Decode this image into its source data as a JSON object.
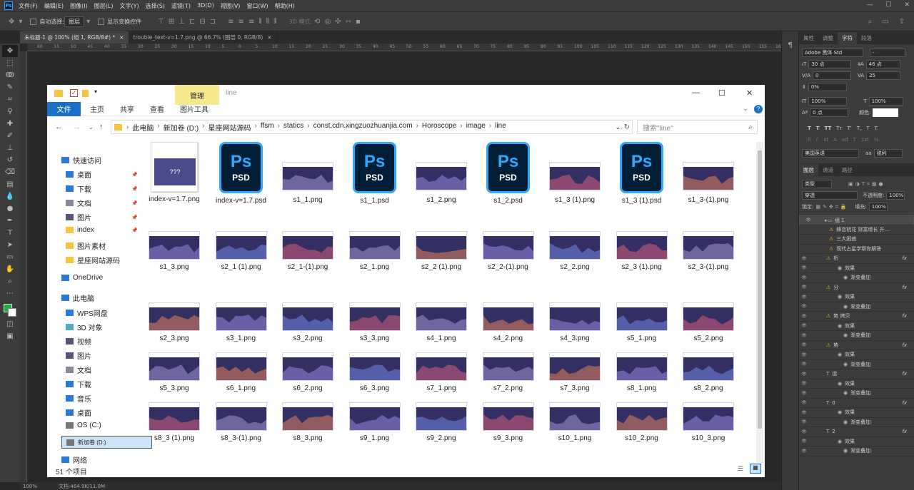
{
  "ps": {
    "menus": [
      "文件(F)",
      "编辑(E)",
      "图像(I)",
      "图层(L)",
      "文字(Y)",
      "选择(S)",
      "滤镜(T)",
      "3D(D)",
      "视图(V)",
      "窗口(W)",
      "帮助(H)"
    ],
    "options": {
      "auto_select": "自动选择:",
      "layer_select": "图层",
      "show_transform": "显示变换控件",
      "mode3d": "3D 模式:"
    },
    "tabs": [
      "未标题-1 @ 100% (组 1, RGB/8#) *",
      "trouble_text-v=1.7.png @ 66.7% (图层 0, RGB/8)"
    ],
    "ruler": [
      "60",
      "55",
      "50",
      "45",
      "40",
      "35",
      "30",
      "25",
      "20",
      "15",
      "10",
      "5",
      "0",
      "5",
      "10",
      "15",
      "20",
      "25",
      "30",
      "35",
      "40",
      "45",
      "50",
      "55",
      "60",
      "65",
      "70",
      "75",
      "80",
      "85",
      "90",
      "95",
      "100",
      "105",
      "110",
      "115",
      "120",
      "125",
      "130",
      "135",
      "140",
      "145",
      "150",
      "155",
      "160"
    ],
    "status": {
      "zoom": "100%",
      "doc": "文档:464.9K/11.0M"
    },
    "char_panel": {
      "tabs": [
        "属性",
        "调整",
        "字符",
        "段落"
      ],
      "font": "Adobe 黑体 Std",
      "style": "-",
      "size": "30 点",
      "leading": "46 点",
      "kerning": "0",
      "tracking": "25",
      "scale_pct": "0%",
      "baseline": "0 点",
      "vscale": "100%",
      "hscale": "100%",
      "color_label": "颜色:",
      "lang": "美国英语",
      "aa": "锐利",
      "styles": [
        "T",
        "T",
        "TT",
        "Tт",
        "T'",
        "T,",
        "T",
        "T"
      ]
    },
    "layers_panel": {
      "tabs": [
        "图层",
        "通道",
        "路径"
      ],
      "kind": "类型",
      "blend": "穿透",
      "opacity_label": "不透明度:",
      "opacity": "100%",
      "lock_label": "锁定:",
      "fill_label": "填充:",
      "fill": "100%",
      "layers": [
        {
          "name": "组 1",
          "type": "group"
        },
        {
          "name": "蜂恋桃花 财富增长 升...",
          "type": "warn"
        },
        {
          "name": "三大困惑",
          "type": "warn"
        },
        {
          "name": "现代占星学帮你解答",
          "type": "warn"
        },
        {
          "name": "析",
          "type": "layer",
          "fx": "fx"
        },
        {
          "name": "效果",
          "type": "effect"
        },
        {
          "name": "渐变叠加",
          "type": "effect2"
        },
        {
          "name": "分",
          "type": "layer",
          "fx": "fx"
        },
        {
          "name": "效果",
          "type": "effect"
        },
        {
          "name": "渐变叠加",
          "type": "effect2"
        },
        {
          "name": "势 拷贝",
          "type": "layer",
          "fx": "fx"
        },
        {
          "name": "效果",
          "type": "effect"
        },
        {
          "name": "渐变叠加",
          "type": "effect2"
        },
        {
          "name": "势",
          "type": "layer",
          "fx": "fx"
        },
        {
          "name": "效果",
          "type": "effect"
        },
        {
          "name": "渐变叠加",
          "type": "effect2"
        },
        {
          "name": "运",
          "type": "text",
          "fx": "fx"
        },
        {
          "name": "效果",
          "type": "effect"
        },
        {
          "name": "渐变叠加",
          "type": "effect2"
        },
        {
          "name": "0",
          "type": "text",
          "fx": "fx"
        },
        {
          "name": "效果",
          "type": "effect"
        },
        {
          "name": "渐变叠加",
          "type": "effect2"
        },
        {
          "name": "2",
          "type": "text",
          "fx": "fx"
        },
        {
          "name": "效果",
          "type": "effect"
        },
        {
          "name": "渐变叠加",
          "type": "effect2"
        }
      ]
    }
  },
  "explorer": {
    "manage": "管理",
    "title": "line",
    "ribbon": [
      "主页",
      "共享",
      "查看",
      "图片工具"
    ],
    "file": "文件",
    "path": [
      "此电脑",
      "新加卷 (D:)",
      "星座网站源码",
      "ffsm",
      "statics",
      "const.cdn.xingzuozhuanjia.com",
      "Horoscope",
      "image",
      "line"
    ],
    "search": "搜索\"line\"",
    "status": "51 个项目",
    "nav": [
      {
        "label": "快速访问",
        "icon": "star-icon",
        "pin": false
      },
      {
        "label": "桌面",
        "icon": "desktop-icon",
        "pin": true
      },
      {
        "label": "下载",
        "icon": "download-icon",
        "pin": true
      },
      {
        "label": "文档",
        "icon": "document-icon",
        "pin": true
      },
      {
        "label": "图片",
        "icon": "picture-icon",
        "pin": true
      },
      {
        "label": "index",
        "icon": "folder-icon",
        "pin": true
      },
      {
        "label": "图片素材",
        "icon": "folder-icon",
        "pin": false
      },
      {
        "label": "星座网站源码",
        "icon": "folder-icon",
        "pin": false
      },
      {
        "label": "OneDrive",
        "icon": "cloud-icon",
        "pin": false
      },
      {
        "label": "此电脑",
        "icon": "computer-icon",
        "pin": false
      },
      {
        "label": "WPS网盘",
        "icon": "cloud-icon",
        "pin": false
      },
      {
        "label": "3D 对象",
        "icon": "cube-icon",
        "pin": false
      },
      {
        "label": "视频",
        "icon": "video-icon",
        "pin": false
      },
      {
        "label": "图片",
        "icon": "picture-icon",
        "pin": false
      },
      {
        "label": "文档",
        "icon": "document-icon",
        "pin": false
      },
      {
        "label": "下载",
        "icon": "download-icon",
        "pin": false
      },
      {
        "label": "音乐",
        "icon": "music-icon",
        "pin": false
      },
      {
        "label": "桌面",
        "icon": "desktop-icon",
        "pin": false
      },
      {
        "label": "OS (C:)",
        "icon": "drive-icon",
        "pin": false
      },
      {
        "label": "新加卷 (D:)",
        "icon": "drive-icon",
        "pin": false
      },
      {
        "label": "网络",
        "icon": "network-icon",
        "pin": false
      }
    ],
    "files": [
      [
        "index-v=1.7.png",
        "index-v=1.7.psd",
        "s1_1.png",
        "s1_1.psd",
        "s1_2.png",
        "s1_2.psd",
        "s1_3 (1).png",
        "s1_3 (1).psd",
        "s1_3-(1).png"
      ],
      [
        "s1_3.png",
        "s2_1 (1).png",
        "s2_1-(1).png",
        "s2_1.png",
        "s2_2 (1).png",
        "s2_2-(1).png",
        "s2_2.png",
        "s2_3 (1).png",
        "s2_3-(1).png"
      ],
      [
        "s2_3.png",
        "s3_1.png",
        "s3_2.png",
        "s3_3.png",
        "s4_1.png",
        "s4_2.png",
        "s4_3.png",
        "s5_1.png",
        "s5_2.png"
      ],
      [
        "s5_3.png",
        "s6_1.png",
        "s6_2.png",
        "s6_3.png",
        "s7_1.png",
        "s7_2.png",
        "s7_3.png",
        "s8_1.png",
        "s8_2.png"
      ],
      [
        "s8_3 (1).png",
        "s8_3-(1).png",
        "s8_3.png",
        "s9_1.png",
        "s9_2.png",
        "s9_3.png",
        "s10_1.png",
        "s10_2.png",
        "s10_3.png"
      ]
    ],
    "index_thumb_text": "???"
  }
}
